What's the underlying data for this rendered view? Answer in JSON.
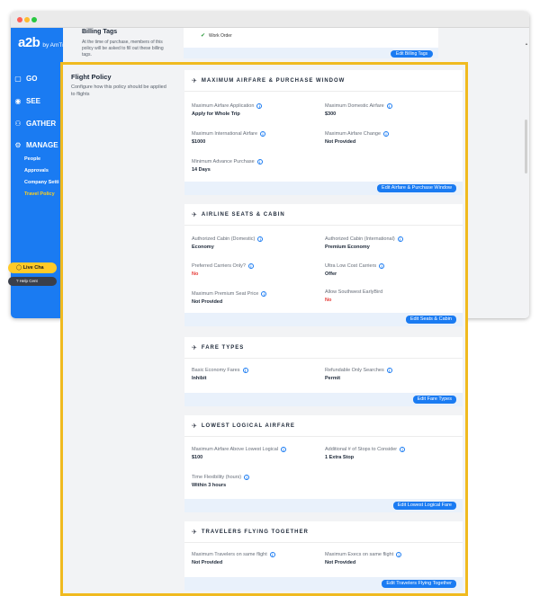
{
  "window_chrome": {
    "controls": [
      "close",
      "minimize",
      "zoom"
    ]
  },
  "sidebar": {
    "logo": "a2b",
    "logo_suffix": "by AmTrav",
    "nav": [
      {
        "label": "GO",
        "icon": "suitcase-icon"
      },
      {
        "label": "SEE",
        "icon": "eye-icon"
      },
      {
        "label": "GATHER",
        "icon": "users-icon"
      },
      {
        "label": "MANAGE",
        "icon": "gear-icon"
      }
    ],
    "manage_items": [
      {
        "label": "People"
      },
      {
        "label": "Approvals"
      },
      {
        "label": "Company Setti"
      },
      {
        "label": "Travel Policy",
        "active": true
      }
    ],
    "live_chat": "Live Cha",
    "help_center": "Help Cent"
  },
  "billing": {
    "title": "Billing Tags",
    "description": "At the time of purchase, members of this policy will be asked to fill out these billing tags.",
    "item": "Work Order",
    "edit_button": "Edit Billing Tags"
  },
  "flight_policy": {
    "title": "Flight Policy",
    "description": "Configure how this policy should be applied to flights",
    "sections": [
      {
        "title": "MAXIMUM AIRFARE & PURCHASE WINDOW",
        "fields": [
          {
            "label": "Maximum Airfare Application",
            "value": "Apply for Whole Trip"
          },
          {
            "label": "Maximum Domestic Airfare",
            "value": "$300"
          },
          {
            "label": "Maximum International Airfare",
            "value": "$1000"
          },
          {
            "label": "Maximum Airfare Change",
            "value": "Not Provided"
          },
          {
            "label": "Minimum Advance Purchase",
            "value": "14 Days"
          }
        ],
        "button": "Edit Airfare & Purchase Window"
      },
      {
        "title": "AIRLINE SEATS & CABIN",
        "fields": [
          {
            "label": "Authorized Cabin (Domestic)",
            "value": "Economy"
          },
          {
            "label": "Authorized Cabin (International)",
            "value": "Premium Economy"
          },
          {
            "label": "Preferred Carriers Only?",
            "value": "No",
            "status": "negative"
          },
          {
            "label": "Ultra Low Cost Carriers",
            "value": "Offer"
          },
          {
            "label": "Maximum Premium Seat Price",
            "value": "Not Provided"
          },
          {
            "label": "Allow Southwest EarlyBird",
            "value": "No",
            "status": "negative"
          }
        ],
        "button": "Edit Seats & Cabin"
      },
      {
        "title": "FARE TYPES",
        "fields": [
          {
            "label": "Basic Economy Fares",
            "value": "Inhibit"
          },
          {
            "label": "Refundable Only Searches",
            "value": "Permit"
          }
        ],
        "button": "Edit Fare Types"
      },
      {
        "title": "LOWEST LOGICAL AIRFARE",
        "fields": [
          {
            "label": "Maximum Airfare Above Lowest Logical",
            "value": "$100"
          },
          {
            "label": "Additional # of Stops to Consider",
            "value": "1 Extra Stop"
          },
          {
            "label": "Time Flexibility (hours)",
            "value": "Within 3 hours"
          }
        ],
        "button": "Edit Lowest Logical Fare"
      },
      {
        "title": "TRAVELERS FLYING TOGETHER",
        "fields": [
          {
            "label": "Maximum Travelers on same flight",
            "value": "Not Provided"
          },
          {
            "label": "Maximum Execs on same flight",
            "value": "Not Provided"
          }
        ],
        "button": "Edit Travelers Flying Together"
      }
    ]
  },
  "colors": {
    "brand_blue": "#1a7bf2",
    "highlight_border": "#f0ba1f",
    "active_nav": "#ffd11a",
    "negative": "#e53935",
    "live_chat": "#ffca28"
  }
}
